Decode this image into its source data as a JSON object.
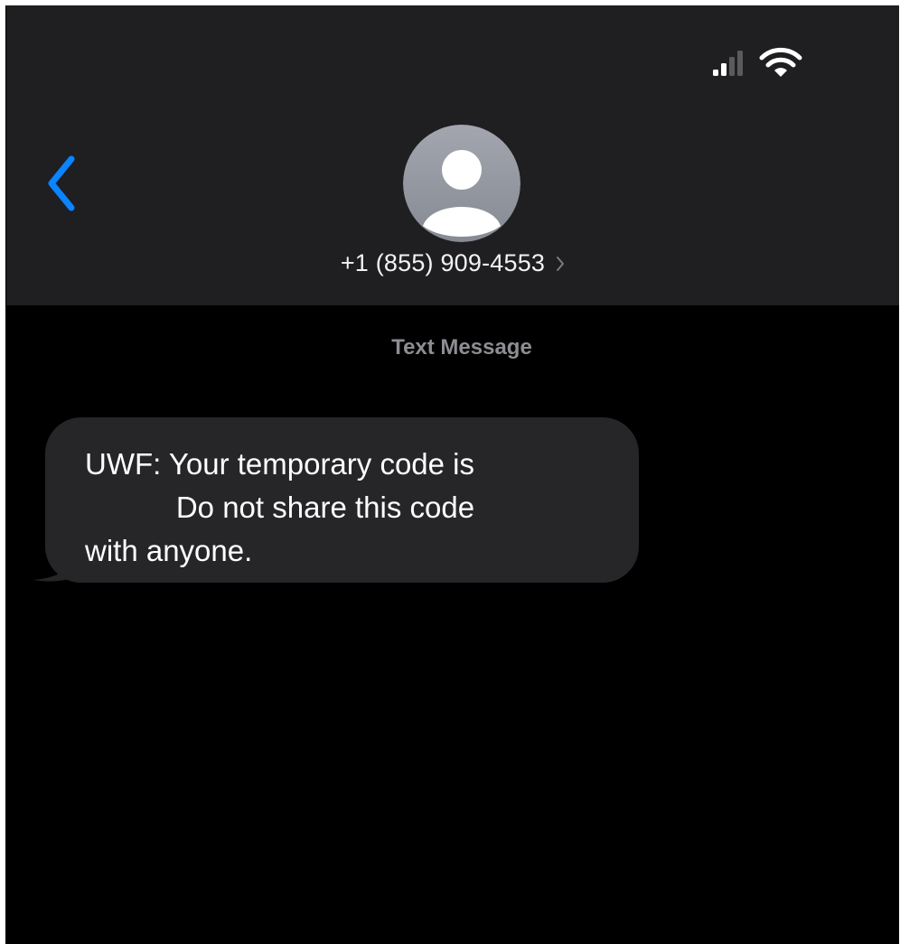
{
  "header": {
    "contact_name": "+1 (855) 909-4553",
    "accent_color": "#0a84ff",
    "icons": {
      "back": "chevron-left-icon",
      "avatar": "person-icon",
      "cellular": "cellular-signal-icon",
      "wifi": "wifi-icon",
      "details": "chevron-right-icon"
    }
  },
  "conversation": {
    "service_label": "Text Message",
    "messages": [
      {
        "direction": "incoming",
        "lines": [
          "UWF: Your temporary code is",
          "           Do not share this code",
          "with anyone."
        ]
      }
    ]
  }
}
